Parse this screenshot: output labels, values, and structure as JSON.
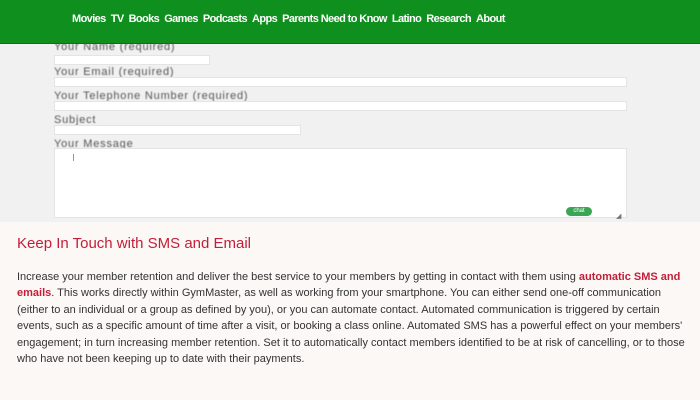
{
  "nav": {
    "items": [
      "Movies",
      "TV",
      "Books",
      "Games",
      "Podcasts",
      "Apps",
      "Parents Need to Know",
      "Latino",
      "Research",
      "About"
    ]
  },
  "form": {
    "name_label": "Your Name (required)",
    "email_label": "Your Email (required)",
    "phone_label": "Your Telephone Number (required)",
    "subject_label": "Subject",
    "message_label": "Your Message",
    "chat_badge": "chat"
  },
  "section": {
    "heading": "Keep In Touch with SMS and Email",
    "text_before": "Increase your member retention and deliver the best service to your members by getting in contact with them using ",
    "link_text": "automatic SMS and emails",
    "text_after": ". This works directly within GymMaster, as well as working from your smartphone. You can either send one-off communication (either to an individual or a group as defined by you), or you can automate contact. Automated communication is triggered by certain events, such as a specific amount of time after a visit, or booking a class online. Automated SMS has a powerful effect on your members' engagement; in turn increasing member retention. Set it to automatically contact members identified to be at risk of cancelling, or to those who have not been keeping up to date with their payments."
  },
  "colors": {
    "nav_background": "#0f8f1e",
    "heading": "#c31e39",
    "link": "#c31e39",
    "body_text": "#333333"
  }
}
